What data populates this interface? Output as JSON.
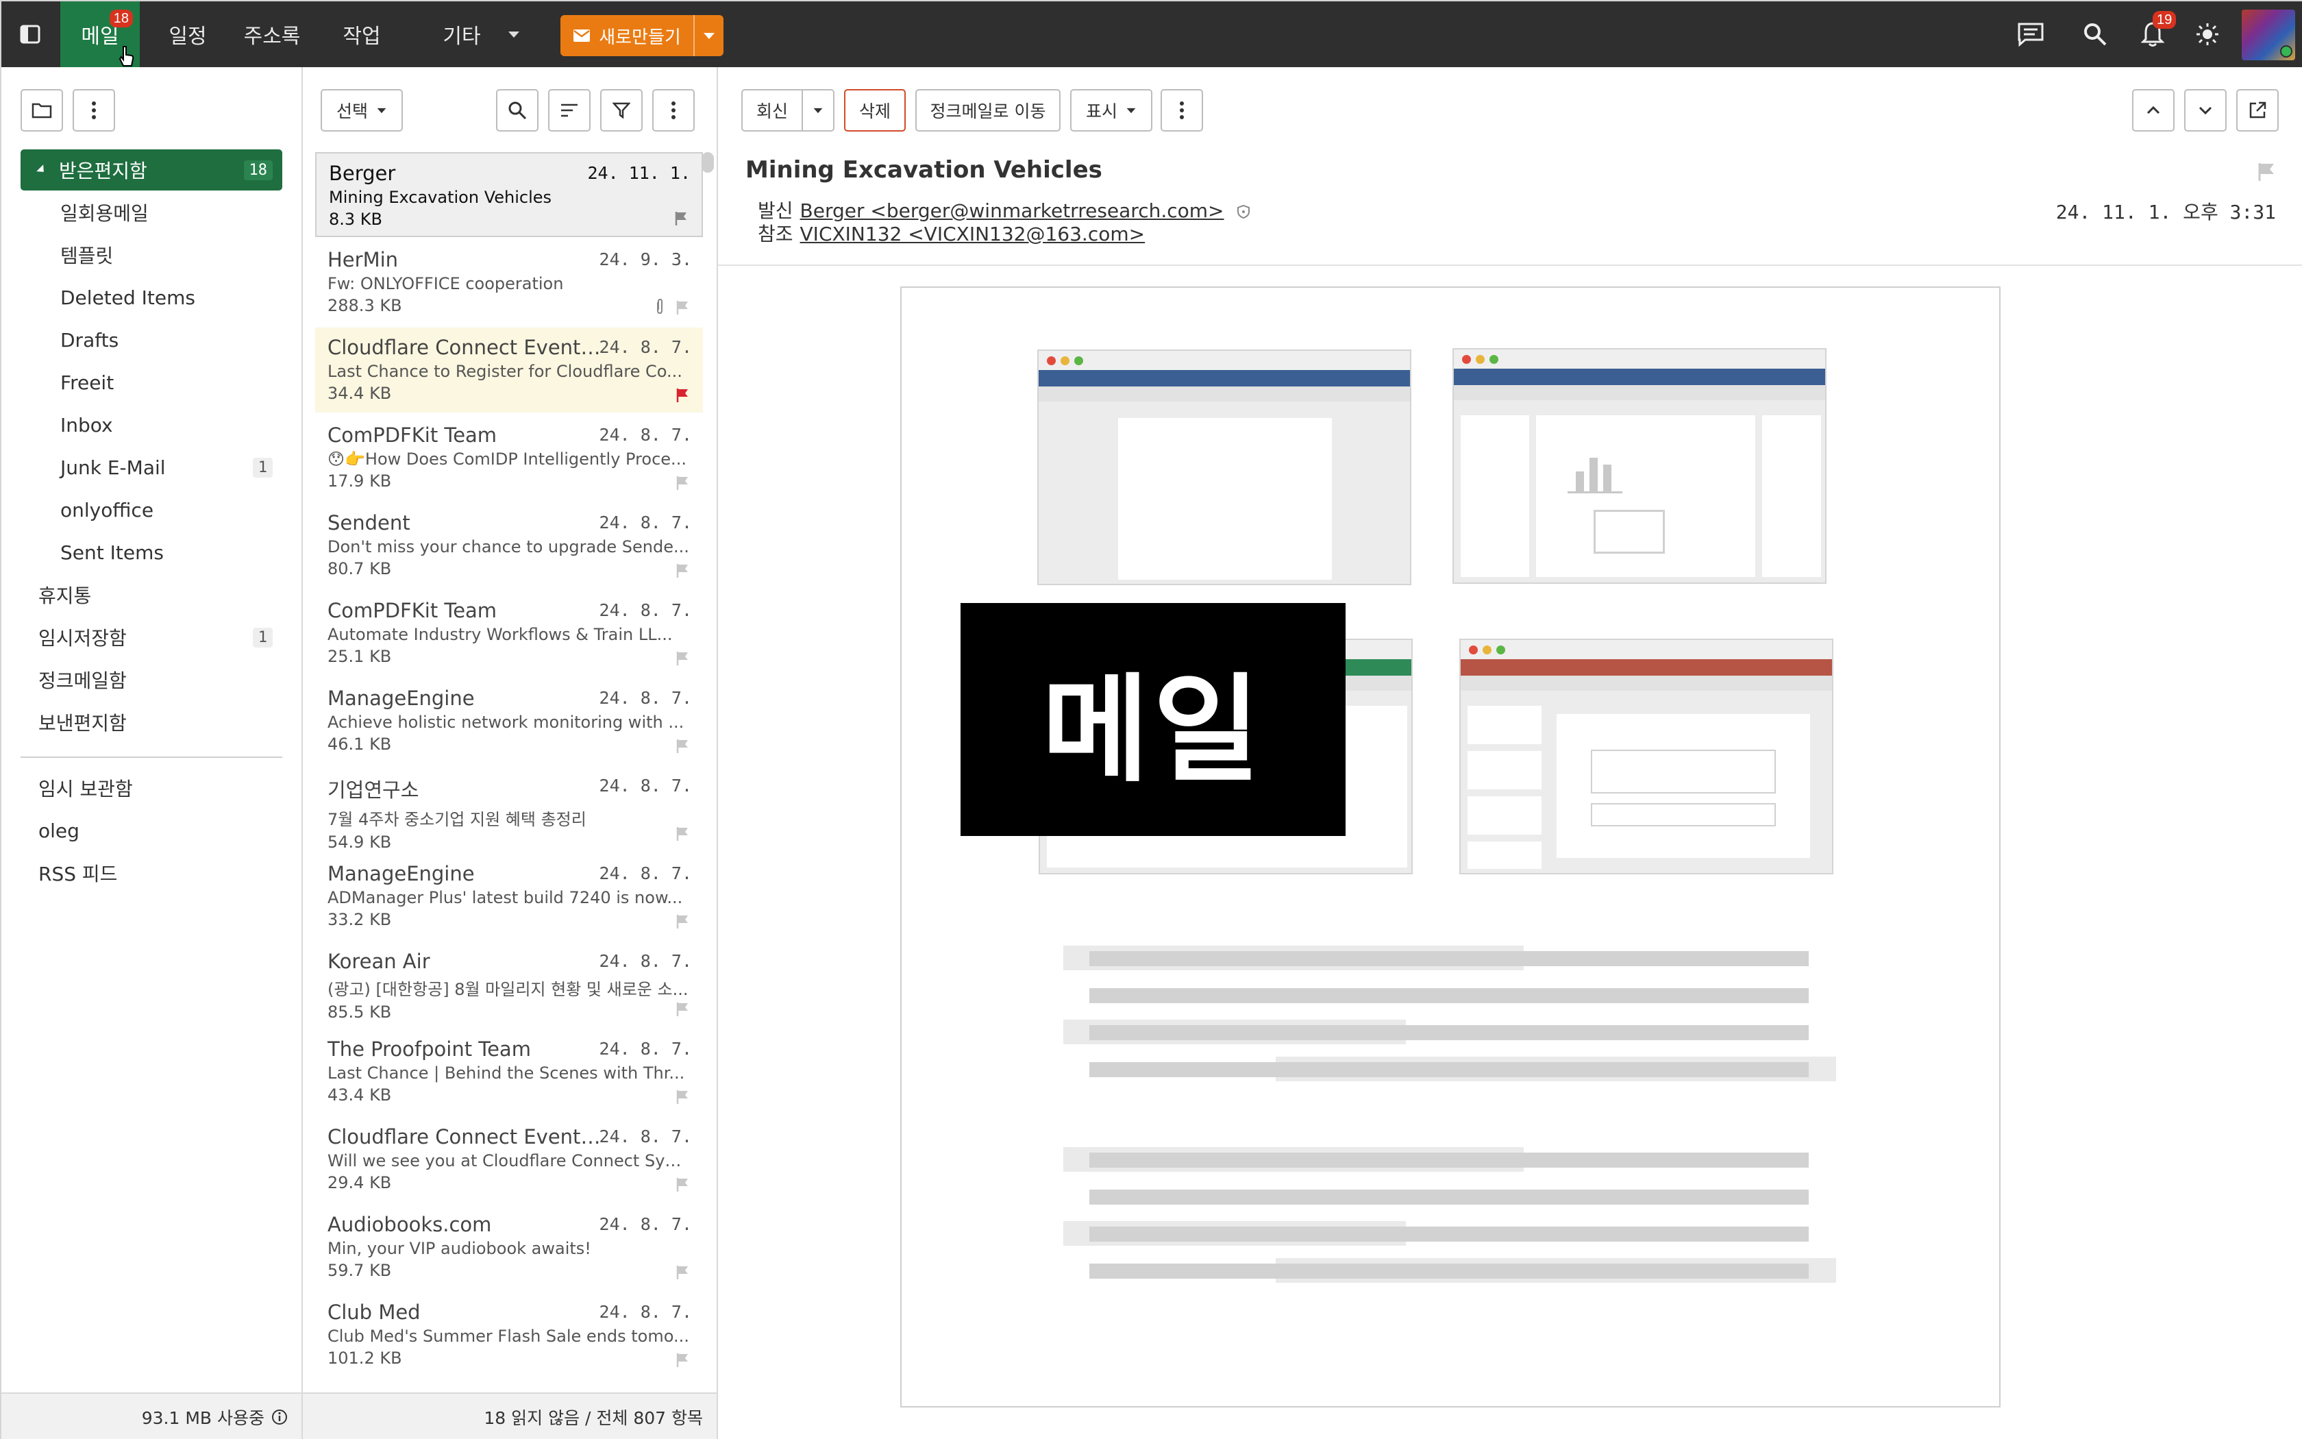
{
  "topbar": {
    "nav": [
      {
        "label": "메일",
        "badge": "18"
      },
      {
        "label": "일정"
      },
      {
        "label": "주소록"
      },
      {
        "label": "작업"
      },
      {
        "label": "기타"
      }
    ],
    "new_button": "새로만들기",
    "notification_badge": "19"
  },
  "folders": {
    "toolbar": {},
    "items": [
      {
        "label": "받은편지함",
        "count": "18"
      },
      {
        "label": "일회용메일"
      },
      {
        "label": "템플릿"
      },
      {
        "label": "Deleted Items"
      },
      {
        "label": "Drafts"
      },
      {
        "label": "Freeit"
      },
      {
        "label": "Inbox"
      },
      {
        "label": "Junk E-Mail",
        "count": "1"
      },
      {
        "label": "onlyoffice"
      },
      {
        "label": "Sent Items"
      },
      {
        "label": "휴지통"
      },
      {
        "label": "임시저장함",
        "count": "1"
      },
      {
        "label": "정크메일함"
      },
      {
        "label": "보낸편지함"
      }
    ],
    "extra": [
      {
        "label": "임시 보관함"
      },
      {
        "label": "oleg"
      },
      {
        "label": "RSS 피드"
      }
    ],
    "quota": "93.1 MB 사용중"
  },
  "list": {
    "select_label": "선택",
    "messages": [
      {
        "from": "Berger",
        "date": "24. 11. 1.",
        "subject": "Mining Excavation Vehicles",
        "size": "8.3 KB"
      },
      {
        "from": "HerMin",
        "date": "24. 9. 3.",
        "subject": "Fw: ONLYOFFICE cooperation",
        "size": "288.3 KB"
      },
      {
        "from": "Cloudflare Connect Event 2...",
        "date": "24. 8. 7.",
        "subject": "Last Chance to Register for Cloudflare Co...",
        "size": "34.4 KB"
      },
      {
        "from": "ComPDFKit Team",
        "date": "24. 8. 7.",
        "subject": "😯👉How Does ComIDP Intelligently Proce...",
        "size": "17.9 KB"
      },
      {
        "from": "Sendent",
        "date": "24. 8. 7.",
        "subject": "Don't miss your chance to upgrade Sende...",
        "size": "80.7 KB"
      },
      {
        "from": "ComPDFKit Team",
        "date": "24. 8. 7.",
        "subject": "Automate Industry Workflows & Train LL...",
        "size": "25.1 KB"
      },
      {
        "from": "ManageEngine",
        "date": "24. 8. 7.",
        "subject": "Achieve holistic network monitoring with ...",
        "size": "46.1 KB"
      },
      {
        "from": "기업연구소",
        "date": "24. 8. 7.",
        "subject": "7월 4주차 중소기업 지원 혜택 총정리",
        "size": "54.9 KB"
      },
      {
        "from": "ManageEngine",
        "date": "24. 8. 7.",
        "subject": "ADManager Plus' latest build 7240 is now...",
        "size": "33.2 KB"
      },
      {
        "from": "Korean Air",
        "date": "24. 8. 7.",
        "subject": "(광고) [대한항공] 8월 마일리지 현황 및 새로운 소...",
        "size": "85.5 KB"
      },
      {
        "from": "The Proofpoint Team",
        "date": "24. 8. 7.",
        "subject": "Last Chance | Behind the Scenes with Thr...",
        "size": "43.4 KB"
      },
      {
        "from": "Cloudflare Connect Event 2...",
        "date": "24. 8. 7.",
        "subject": "Will we see you at Cloudflare Connect Syd...",
        "size": "29.4 KB"
      },
      {
        "from": "Audiobooks.com",
        "date": "24. 8. 7.",
        "subject": "Min, your VIP audiobook awaits!",
        "size": "59.7 KB"
      },
      {
        "from": "Club Med",
        "date": "24. 8. 7.",
        "subject": "Club Med's Summer Flash Sale ends tomo...",
        "size": "101.2 KB"
      }
    ],
    "status": "18 읽지 않음 / 전체 807 항목"
  },
  "reader": {
    "toolbar": {
      "reply": "회신",
      "delete": "삭제",
      "junk": "정크메일로 이동",
      "view": "표시"
    },
    "subject": "Mining Excavation Vehicles",
    "from_label": "발신",
    "from": "Berger <berger@winmarketrresearch.com>",
    "cc_label": "참조",
    "cc": "VICXIN132 <VICXIN132@163.com>",
    "date": "24. 11. 1. 오후 3:31",
    "image_text": "메일"
  },
  "colors": {
    "topbar": "#2f2f2f",
    "active_nav": "#1e7b45",
    "new_button": "#ea7b12",
    "selected_folder": "#1e6e3f",
    "badge": "#d7331f",
    "flag_red": "#d9232e"
  }
}
